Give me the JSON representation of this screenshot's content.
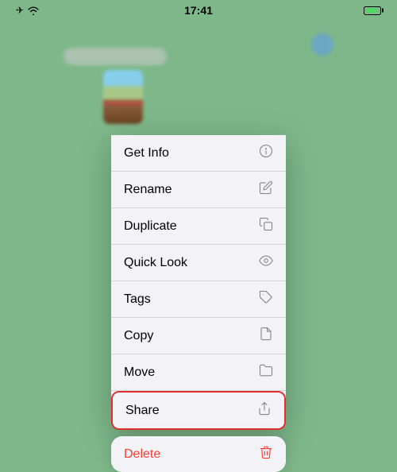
{
  "statusBar": {
    "time": "17:41",
    "icons": {
      "airplane": "✈",
      "wifi": "wifi"
    }
  },
  "contextMenu": {
    "mainItems": [
      {
        "id": "get-info",
        "label": "Get Info",
        "icon": "info"
      },
      {
        "id": "rename",
        "label": "Rename",
        "icon": "pencil"
      },
      {
        "id": "duplicate",
        "label": "Duplicate",
        "icon": "duplicate"
      },
      {
        "id": "quick-look",
        "label": "Quick Look",
        "icon": "eye"
      },
      {
        "id": "tags",
        "label": "Tags",
        "icon": "tag"
      },
      {
        "id": "copy",
        "label": "Copy",
        "icon": "copy"
      },
      {
        "id": "move",
        "label": "Move",
        "icon": "folder"
      },
      {
        "id": "share",
        "label": "Share",
        "icon": "share"
      }
    ],
    "deleteItem": {
      "id": "delete",
      "label": "Delete",
      "icon": "trash"
    }
  },
  "colors": {
    "accent": "#e03030",
    "background": "#7eb88a",
    "menuBg": "#f2f2f7",
    "separator": "rgba(0,0,0,0.12)"
  }
}
